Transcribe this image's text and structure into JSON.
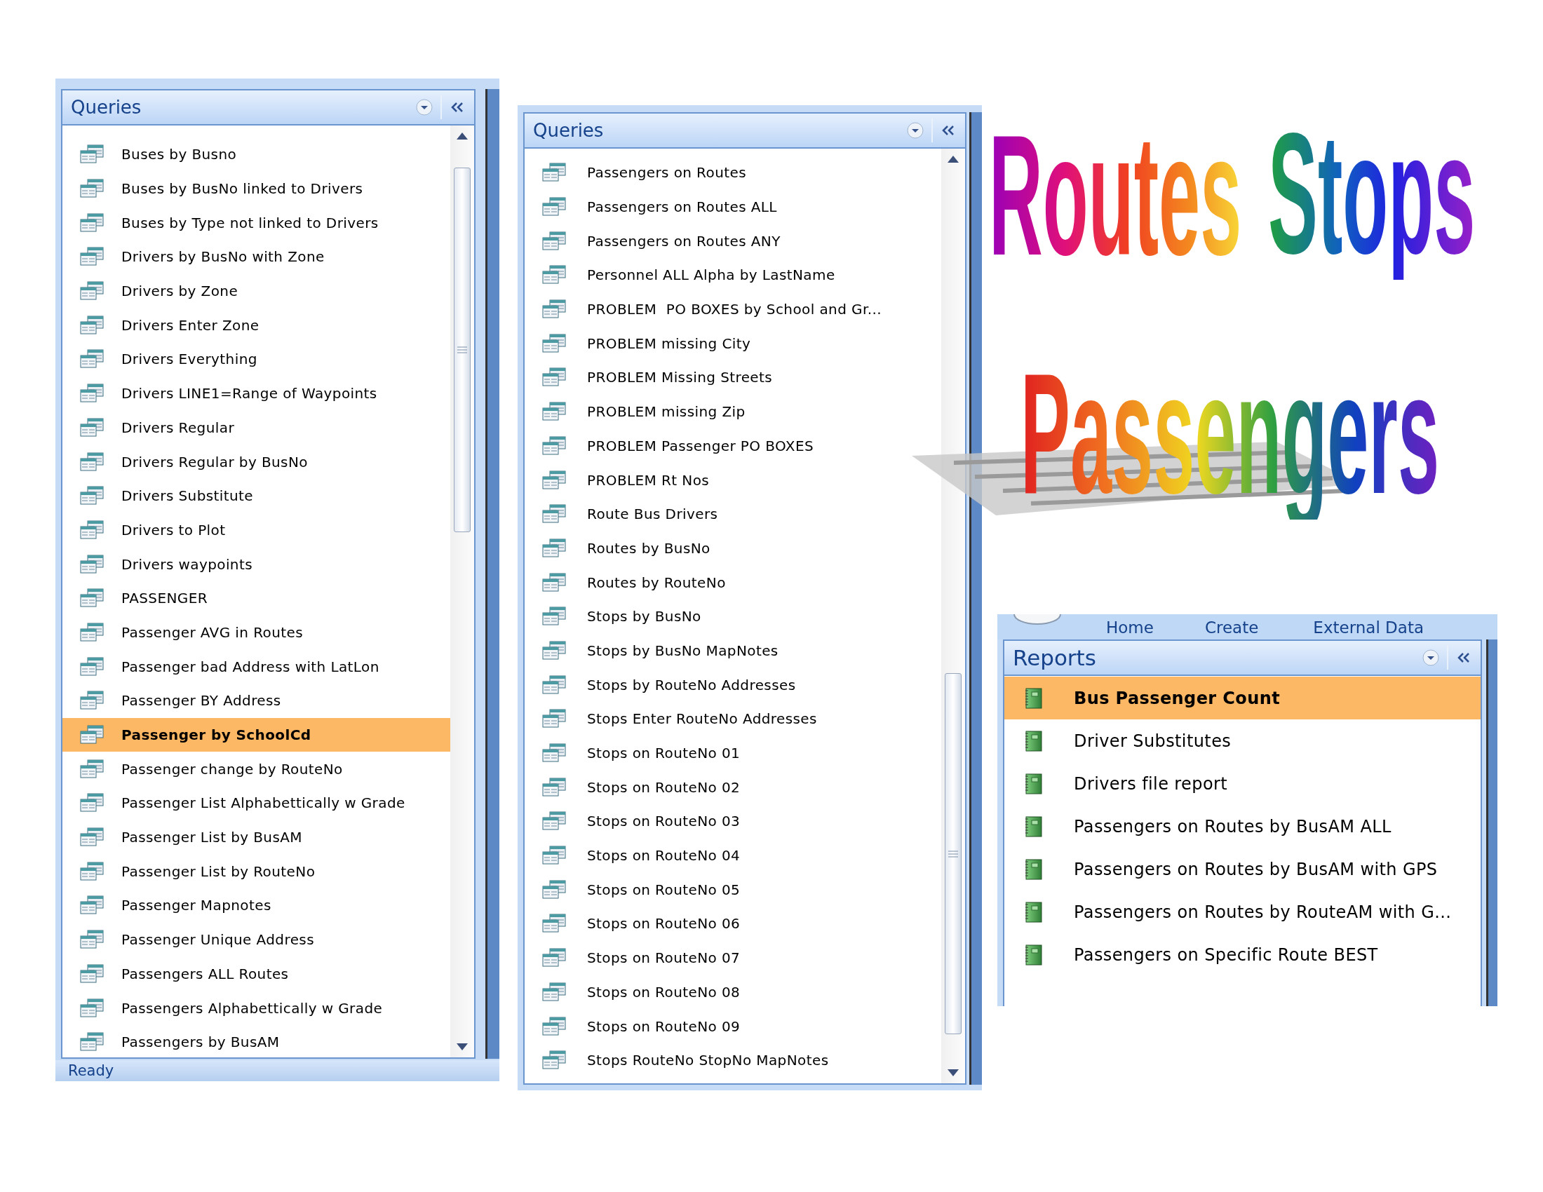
{
  "query_panes": [
    {
      "title": "Queries",
      "items": [
        {
          "label": "Buses by Busno",
          "selected": false
        },
        {
          "label": "Buses by BusNo linked to Drivers",
          "selected": false
        },
        {
          "label": "Buses by Type not linked to Drivers",
          "selected": false
        },
        {
          "label": "Drivers by BusNo with Zone",
          "selected": false
        },
        {
          "label": "Drivers by Zone",
          "selected": false
        },
        {
          "label": "Drivers Enter Zone",
          "selected": false
        },
        {
          "label": "Drivers Everything",
          "selected": false
        },
        {
          "label": "Drivers LINE1=Range of Waypoints",
          "selected": false
        },
        {
          "label": "Drivers Regular",
          "selected": false
        },
        {
          "label": "Drivers Regular by BusNo",
          "selected": false
        },
        {
          "label": "Drivers Substitute",
          "selected": false
        },
        {
          "label": "Drivers to Plot",
          "selected": false
        },
        {
          "label": "Drivers waypoints",
          "selected": false
        },
        {
          "label": "PASSENGER",
          "selected": false
        },
        {
          "label": "Passenger AVG in Routes",
          "selected": false
        },
        {
          "label": "Passenger bad Address with LatLon",
          "selected": false
        },
        {
          "label": "Passenger BY Address",
          "selected": false
        },
        {
          "label": "Passenger by SchoolCd",
          "selected": true
        },
        {
          "label": "Passenger change by RouteNo",
          "selected": false
        },
        {
          "label": "Passenger List Alphabettically w Grade",
          "selected": false
        },
        {
          "label": "Passenger List by BusAM",
          "selected": false
        },
        {
          "label": "Passenger List by RouteNo",
          "selected": false
        },
        {
          "label": "Passenger Mapnotes",
          "selected": false
        },
        {
          "label": "Passenger Unique Address",
          "selected": false
        },
        {
          "label": "Passengers ALL Routes",
          "selected": false
        },
        {
          "label": "Passengers Alphabettically w Grade",
          "selected": false
        },
        {
          "label": "Passengers by BusAM",
          "selected": false
        }
      ],
      "status_bar": "Ready"
    },
    {
      "title": "Queries",
      "items": [
        {
          "label": "Passengers on Routes",
          "selected": false
        },
        {
          "label": "Passengers on Routes ALL",
          "selected": false
        },
        {
          "label": "Passengers on Routes ANY",
          "selected": false
        },
        {
          "label": "Personnel ALL Alpha by LastName",
          "selected": false
        },
        {
          "label": "PROBLEM  PO BOXES by School and Gr...",
          "selected": false
        },
        {
          "label": "PROBLEM missing City",
          "selected": false
        },
        {
          "label": "PROBLEM Missing Streets",
          "selected": false
        },
        {
          "label": "PROBLEM missing Zip",
          "selected": false
        },
        {
          "label": "PROBLEM Passenger PO BOXES",
          "selected": false
        },
        {
          "label": "PROBLEM Rt Nos",
          "selected": false
        },
        {
          "label": "Route Bus Drivers",
          "selected": false
        },
        {
          "label": "Routes by BusNo",
          "selected": false
        },
        {
          "label": "Routes by RouteNo",
          "selected": false
        },
        {
          "label": "Stops by BusNo",
          "selected": false
        },
        {
          "label": "Stops by BusNo MapNotes",
          "selected": false
        },
        {
          "label": "Stops by RouteNo Addresses",
          "selected": false
        },
        {
          "label": "Stops Enter RouteNo Addresses",
          "selected": false
        },
        {
          "label": "Stops on RouteNo 01",
          "selected": false
        },
        {
          "label": "Stops on RouteNo 02",
          "selected": false
        },
        {
          "label": "Stops on RouteNo 03",
          "selected": false
        },
        {
          "label": "Stops on RouteNo 04",
          "selected": false
        },
        {
          "label": "Stops on RouteNo 05",
          "selected": false
        },
        {
          "label": "Stops on RouteNo 06",
          "selected": false
        },
        {
          "label": "Stops on RouteNo 07",
          "selected": false
        },
        {
          "label": "Stops on RouteNo 08",
          "selected": false
        },
        {
          "label": "Stops on RouteNo 09",
          "selected": false
        },
        {
          "label": "Stops RouteNo StopNo MapNotes",
          "selected": false
        }
      ]
    }
  ],
  "reports_pane": {
    "ribbon_tabs": [
      "Home",
      "Create",
      "External Data"
    ],
    "title": "Reports",
    "items": [
      {
        "label": "Bus Passenger Count",
        "selected": true
      },
      {
        "label": "Driver Substitutes",
        "selected": false
      },
      {
        "label": "Drivers file report",
        "selected": false
      },
      {
        "label": "Passengers on Routes by BusAM ALL",
        "selected": false
      },
      {
        "label": "Passengers on Routes by BusAM with GPS",
        "selected": false
      },
      {
        "label": "Passengers on Routes by RouteAM with G...",
        "selected": false
      },
      {
        "label": "Passengers on Specific Route BEST",
        "selected": false
      }
    ]
  },
  "wordart": [
    "Routes",
    "Stops",
    "Passengers"
  ]
}
